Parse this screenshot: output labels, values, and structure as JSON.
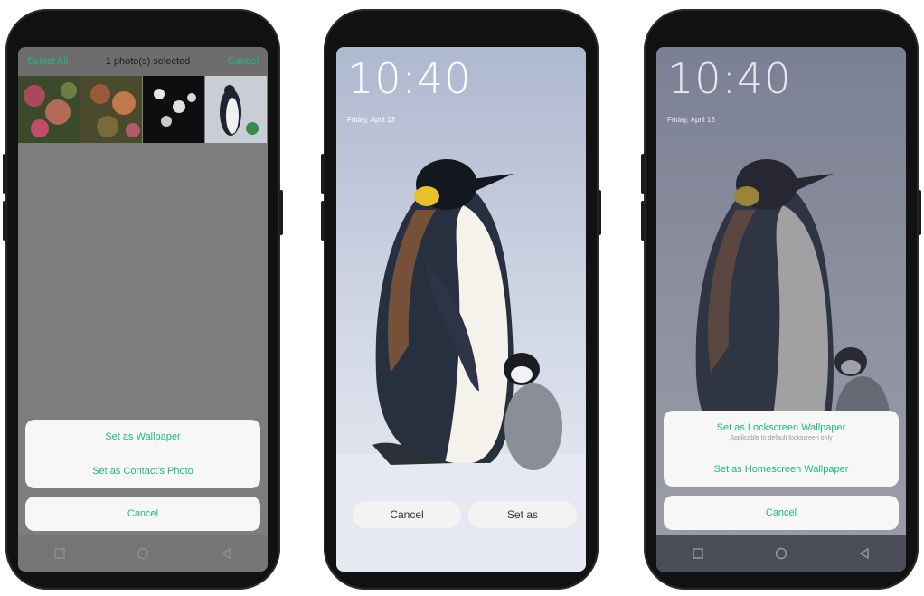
{
  "phone1": {
    "select_all": "Select All",
    "selected_text": "1 photo(s) selected",
    "cancel_top": "Cancel",
    "sheet_items": [
      "Set as Wallpaper",
      "Set as Contact's Photo"
    ],
    "cancel_sheet": "Cancel",
    "nav_icons": [
      "square-icon",
      "circle-icon",
      "triangle-back-icon"
    ]
  },
  "phone2": {
    "time": "10:40",
    "date": "Friday, April 13",
    "cancel_button": "Cancel",
    "set_as_button": "Set as"
  },
  "phone3": {
    "time": "10:40",
    "date": "Friday, April 13",
    "option_lockscreen": "Set as Lockscreen Wallpaper",
    "option_lockscreen_sub": "Applicable to default lockscreen only",
    "option_homescreen": "Set as Homescreen Wallpaper",
    "cancel_sheet": "Cancel",
    "nav_icons": [
      "square-icon",
      "circle-icon",
      "triangle-back-icon"
    ]
  },
  "colors": {
    "accent": "#1fb97f",
    "sheet_bg": "#f7f7f7"
  }
}
